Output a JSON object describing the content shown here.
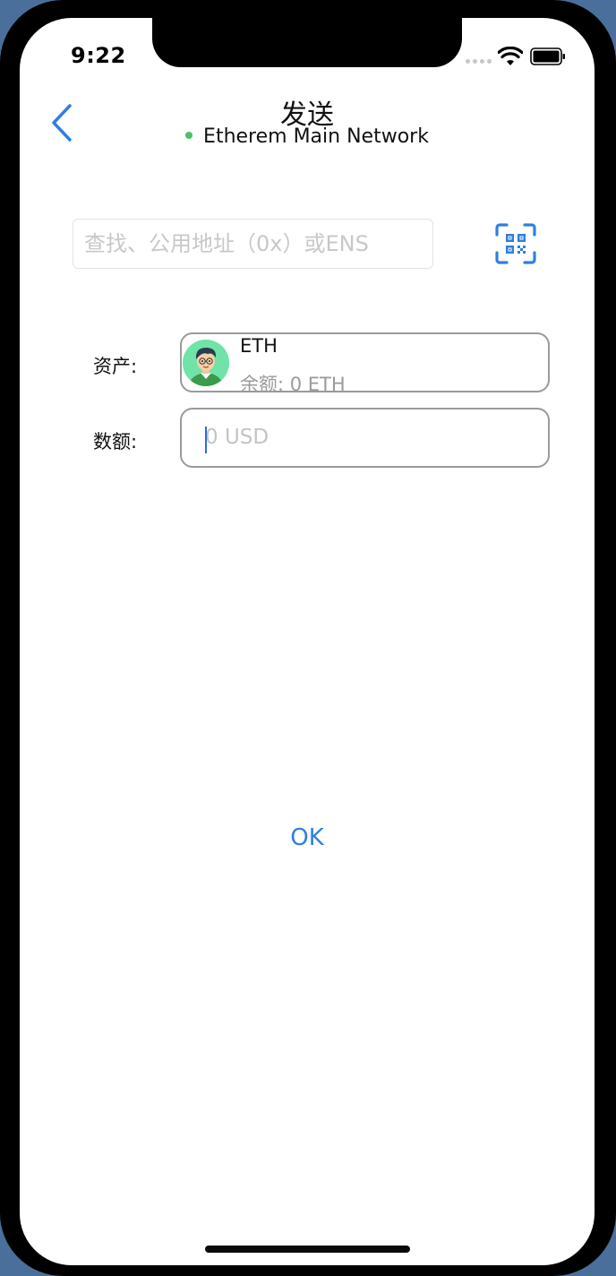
{
  "status_bar": {
    "time": "9:22"
  },
  "header": {
    "title": "发送",
    "network": "Etherem Main Network",
    "network_dot_color": "#4ec06a"
  },
  "search": {
    "placeholder": "查找、公用地址（0x）或ENS",
    "value": ""
  },
  "asset": {
    "label": "资产:",
    "name": "ETH",
    "balance": "余额: 0 ETH",
    "avatar_icon": "avatar-person-icon"
  },
  "amount": {
    "label": "数额:",
    "placeholder": "0 USD"
  },
  "actions": {
    "ok_label": "OK"
  },
  "colors": {
    "accent": "#2f7fe0",
    "border": "#9a9a9a",
    "placeholder": "#c4c4c4"
  }
}
